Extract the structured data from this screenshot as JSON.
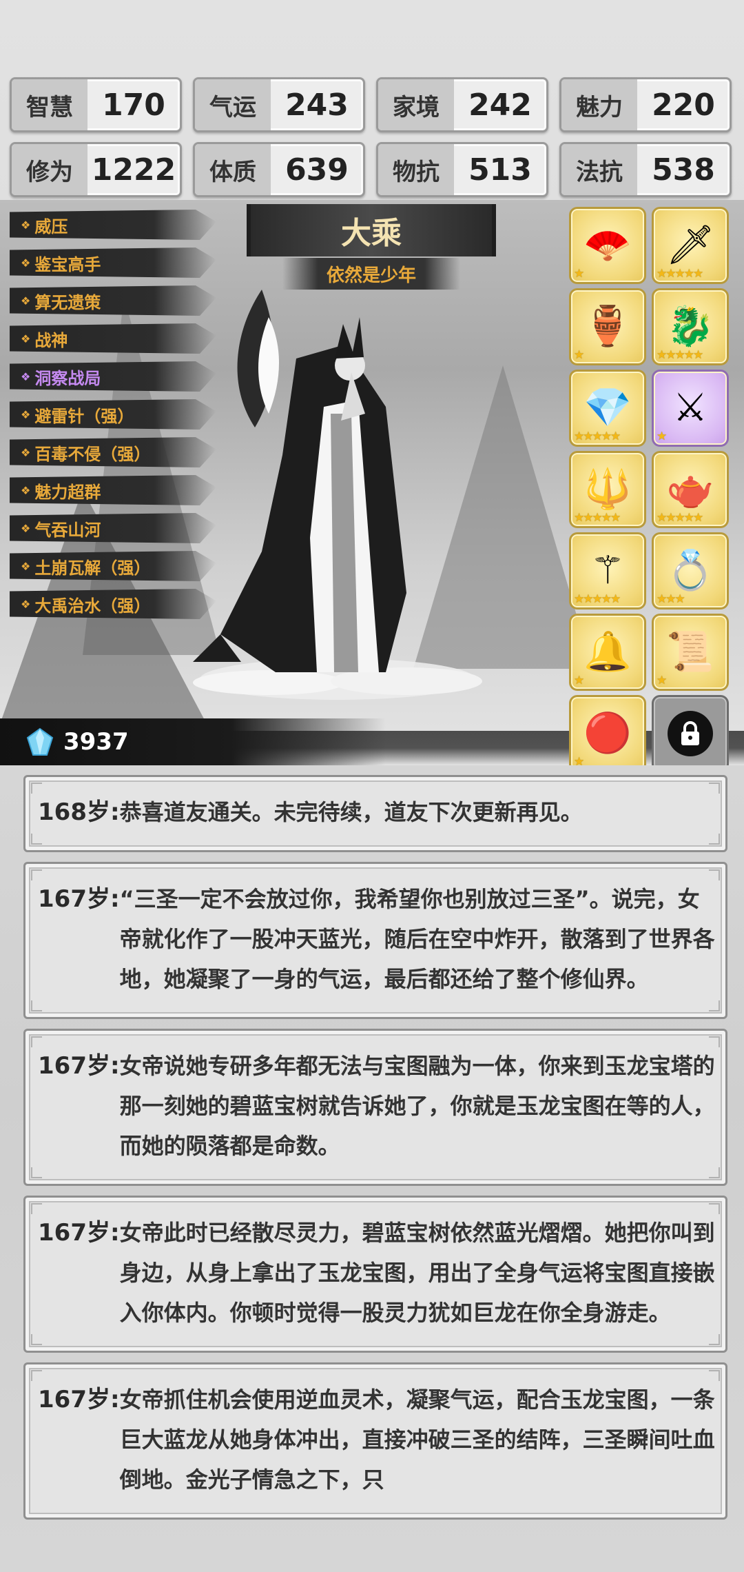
{
  "stats": [
    [
      {
        "label": "智慧",
        "value": "170"
      },
      {
        "label": "气运",
        "value": "243"
      },
      {
        "label": "家境",
        "value": "242"
      },
      {
        "label": "魅力",
        "value": "220"
      }
    ],
    [
      {
        "label": "修为",
        "value": "1222"
      },
      {
        "label": "体质",
        "value": "639"
      },
      {
        "label": "物抗",
        "value": "513"
      },
      {
        "label": "法抗",
        "value": "538"
      }
    ]
  ],
  "skills": [
    {
      "label": "威压",
      "color": "#e8a93a"
    },
    {
      "label": "鉴宝高手",
      "color": "#e8a93a"
    },
    {
      "label": "算无遗策",
      "color": "#e8a93a"
    },
    {
      "label": "战神",
      "color": "#e8a93a"
    },
    {
      "label": "洞察战局",
      "color": "#c58af0"
    },
    {
      "label": "避雷针（强）",
      "color": "#e8a93a"
    },
    {
      "label": "百毒不侵（强）",
      "color": "#e8a93a"
    },
    {
      "label": "魅力超群",
      "color": "#e8a93a"
    },
    {
      "label": "气吞山河",
      "color": "#e8a93a"
    },
    {
      "label": "土崩瓦解（强）",
      "color": "#e8a93a"
    },
    {
      "label": "大禹治水（强）",
      "color": "#e8a93a"
    }
  ],
  "rank": {
    "title": "大乘",
    "subtitle": "依然是少年"
  },
  "gems": {
    "icon": "crystal-icon",
    "count": "3937"
  },
  "items": [
    {
      "icon": "fan-icon",
      "glyph": "🪭",
      "stars": 1,
      "rarity": "gold"
    },
    {
      "icon": "jade-sword-icon",
      "glyph": "🗡",
      "stars": 5,
      "rarity": "gold"
    },
    {
      "icon": "cauldron-icon",
      "glyph": "🏺",
      "stars": 1,
      "rarity": "gold"
    },
    {
      "icon": "dragon-boat-icon",
      "glyph": "🐉",
      "stars": 5,
      "rarity": "gold"
    },
    {
      "icon": "rainbow-crystal-icon",
      "glyph": "💎",
      "stars": 5,
      "rarity": "gold"
    },
    {
      "icon": "silver-sword-icon",
      "glyph": "⚔",
      "stars": 1,
      "rarity": "purple"
    },
    {
      "icon": "blue-blade-icon",
      "glyph": "🔱",
      "stars": 5,
      "rarity": "gold"
    },
    {
      "icon": "teapot-icon",
      "glyph": "🫖",
      "stars": 5,
      "rarity": "gold"
    },
    {
      "icon": "golden-staff-icon",
      "glyph": "⚚",
      "stars": 5,
      "rarity": "gold"
    },
    {
      "icon": "ruby-ring-icon",
      "glyph": "💍",
      "stars": 3,
      "rarity": "gold"
    },
    {
      "icon": "golden-scepter-icon",
      "glyph": "🔔",
      "stars": 1,
      "rarity": "gold"
    },
    {
      "icon": "scroll-icon",
      "glyph": "📜",
      "stars": 1,
      "rarity": "gold"
    },
    {
      "icon": "red-orb-icon",
      "glyph": "🔴",
      "stars": 1,
      "rarity": "gold"
    },
    {
      "icon": "lock-icon",
      "glyph": "🔒",
      "stars": 0,
      "rarity": "locked"
    }
  ],
  "logs": [
    {
      "age": "168岁:",
      "text": "恭喜道友通关。未完待续，道友下次更新再见。"
    },
    {
      "age": "167岁:",
      "text": "“三圣一定不会放过你，我希望你也别放过三圣”。说完，女帝就化作了一股冲天蓝光，随后在空中炸开，散落到了世界各地，她凝聚了一身的气运，最后都还给了整个修仙界。"
    },
    {
      "age": "167岁:",
      "text": "女帝说她专研多年都无法与宝图融为一体，你来到玉龙宝塔的那一刻她的碧蓝宝树就告诉她了，你就是玉龙宝图在等的人，而她的陨落都是命数。"
    },
    {
      "age": "167岁:",
      "text": "女帝此时已经散尽灵力，碧蓝宝树依然蓝光熠熠。她把你叫到身边，从身上拿出了玉龙宝图，用出了全身气运将宝图直接嵌入你体内。你顿时觉得一股灵力犹如巨龙在你全身游走。"
    },
    {
      "age": "167岁:",
      "text": "女帝抓住机会使用逆血灵术，凝聚气运，配合玉龙宝图，一条巨大蓝龙从她身体冲出，直接冲破三圣的结阵，三圣瞬间吐血倒地。金光子情急之下，只"
    }
  ]
}
